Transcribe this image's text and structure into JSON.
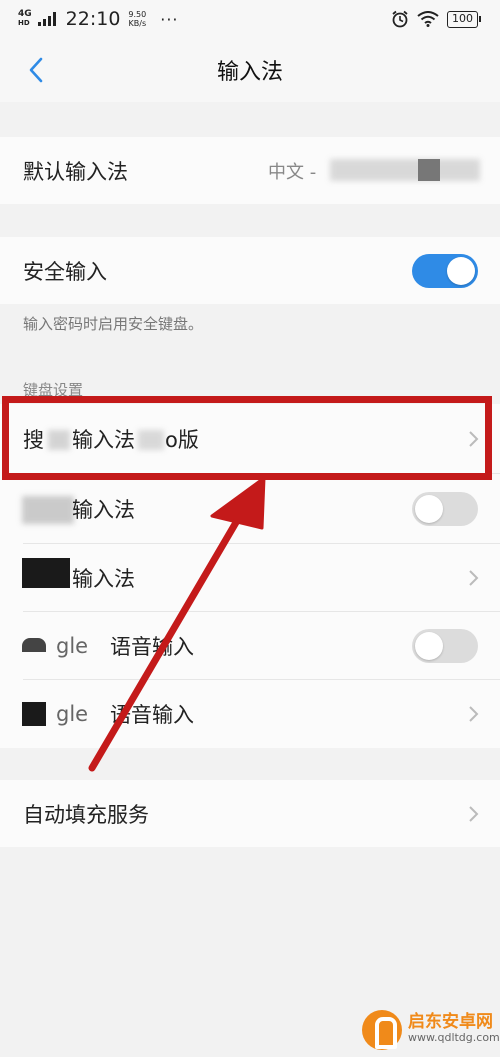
{
  "status_bar": {
    "network": "4G",
    "network_sub": "HD",
    "time": "22:10",
    "speed_value": "9.50",
    "speed_unit": "KB/s",
    "more": "···",
    "battery": "100"
  },
  "nav": {
    "title": "输入法"
  },
  "default_ime": {
    "label": "默认输入法",
    "value": "中文 - "
  },
  "secure_input": {
    "label": "安全输入",
    "enabled": true,
    "hint": "输入密码时启用安全键盘。"
  },
  "keyboard_settings": {
    "header": "键盘设置",
    "items": [
      {
        "label_prefix": "搜",
        "label": "输入法",
        "label_suffix": "o版",
        "control": "chevron"
      },
      {
        "label": "输入法",
        "control": "toggle",
        "enabled": false
      },
      {
        "label": "输入法",
        "control": "chevron"
      },
      {
        "label_prefix": "gle",
        "label": "语音输入",
        "control": "toggle",
        "enabled": false
      },
      {
        "label_prefix": "gle",
        "label": "语音输入",
        "control": "chevron"
      }
    ]
  },
  "autofill": {
    "label": "自动填充服务"
  },
  "watermark": {
    "name": "启东安卓网",
    "url": "www.qdltdg.com"
  },
  "colors": {
    "accent": "#2f8be6",
    "highlight": "#c41a1a"
  }
}
